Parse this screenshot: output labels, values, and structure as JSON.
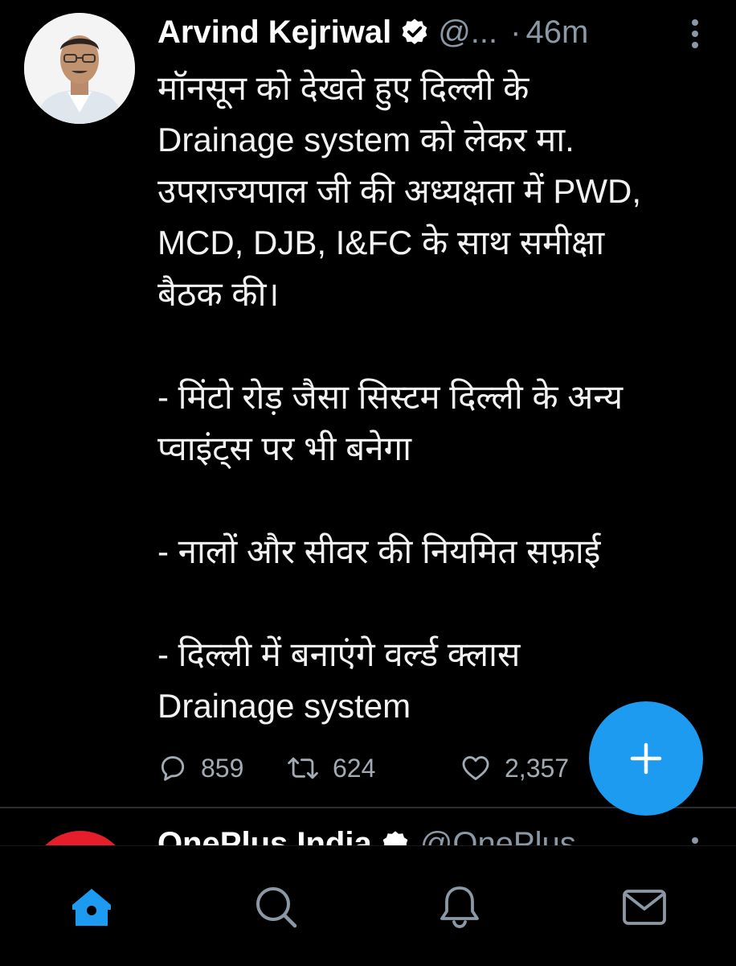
{
  "colors": {
    "background": "#000000",
    "accent": "#1d9bf0",
    "muted": "#8b98a5",
    "text": "#f2f2f2"
  },
  "tweet": {
    "author_name": "Arvind Kejriwal",
    "handle": "@...",
    "time": "46m",
    "verified": true,
    "text_lines": [
      "मॉनसून को देखते हुए दिल्ली के",
      "Drainage system को लेकर मा.",
      "उपराज्यपाल जी की अध्यक्षता में PWD,",
      "MCD, DJB, I&FC के साथ समीक्षा",
      "बैठक की।",
      "",
      "- मिंटो रोड़ जैसा सिस्टम दिल्ली के अन्य",
      "प्वाइंट्स पर भी बनेगा",
      "",
      "- नालों और सीवर की नियमित सफ़ाई",
      "",
      "- दिल्ली में बनाएंगे वर्ल्ड क्लास",
      "Drainage system"
    ],
    "replies": "859",
    "retweets": "624",
    "likes": "2,357"
  },
  "next_tweet": {
    "author_name": "OnePlus India",
    "handle": "@OnePlus"
  },
  "icons": {
    "reply": "reply-icon",
    "retweet": "retweet-icon",
    "like": "heart-icon",
    "compose": "plus-icon",
    "home": "home-icon",
    "search": "search-icon",
    "notifications": "bell-icon",
    "messages": "mail-icon"
  }
}
